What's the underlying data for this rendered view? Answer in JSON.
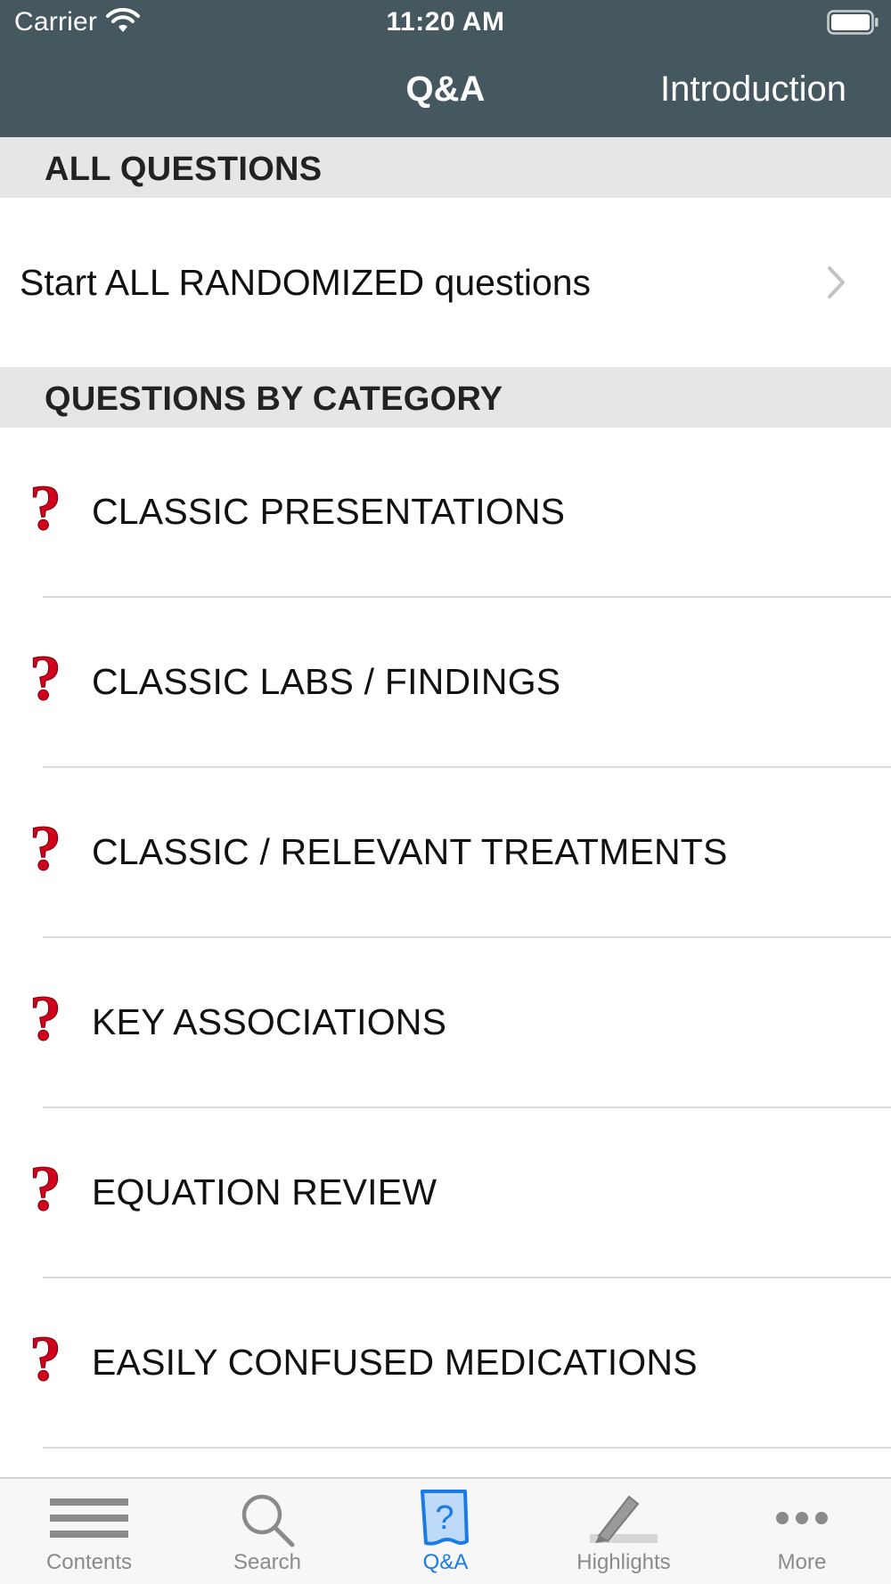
{
  "status_bar": {
    "carrier": "Carrier",
    "time": "11:20 AM"
  },
  "nav": {
    "title": "Q&A",
    "right_button": "Introduction"
  },
  "sections": {
    "all_questions": {
      "header": "ALL QUESTIONS",
      "randomized_label": "Start ALL RANDOMIZED questions"
    },
    "by_category": {
      "header": "QUESTIONS BY CATEGORY",
      "items": [
        {
          "label": "CLASSIC PRESENTATIONS",
          "icon": "question-mark-icon"
        },
        {
          "label": "CLASSIC LABS / FINDINGS",
          "icon": "question-mark-icon"
        },
        {
          "label": "CLASSIC / RELEVANT TREATMENTS",
          "icon": "question-mark-icon"
        },
        {
          "label": "KEY ASSOCIATIONS",
          "icon": "question-mark-icon"
        },
        {
          "label": "EQUATION REVIEW",
          "icon": "question-mark-icon"
        },
        {
          "label": "EASILY CONFUSED MEDICATIONS",
          "icon": "question-mark-icon"
        }
      ]
    }
  },
  "tabbar": {
    "tabs": [
      {
        "label": "Contents",
        "icon": "list-icon"
      },
      {
        "label": "Search",
        "icon": "search-icon"
      },
      {
        "label": "Q&A",
        "icon": "question-page-icon",
        "active": true
      },
      {
        "label": "Highlights",
        "icon": "highlighter-icon"
      },
      {
        "label": "More",
        "icon": "more-dots-icon"
      }
    ]
  },
  "colors": {
    "nav_background": "#46585f",
    "section_header_background": "#e6e6e6",
    "question_mark_red": "#d0021b",
    "active_tab_blue": "#1a7ae6",
    "inactive_tab_gray": "#8a8a8a"
  }
}
